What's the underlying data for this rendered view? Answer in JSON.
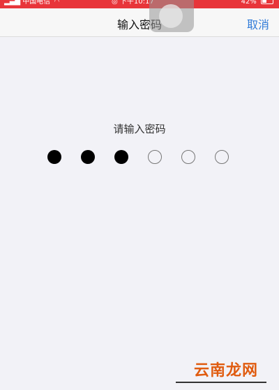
{
  "status_bar": {
    "carrier": "中国电信",
    "time": "下午10:17",
    "battery": "42%",
    "battery_level": 0.42,
    "icons": [
      "signal-icon",
      "wifi-icon",
      "alarm-icon",
      "battery-icon"
    ]
  },
  "nav": {
    "title": "输入密码",
    "cancel_label": "取消"
  },
  "main": {
    "prompt": "请输入密码",
    "passcode_length": 6,
    "digits_entered": 3
  },
  "watermark": "云南龙网",
  "colors": {
    "status_bar_bg": "#e8353a",
    "accent": "#2f7ad8",
    "background": "#f2f2f7",
    "watermark": "#e05c10"
  }
}
